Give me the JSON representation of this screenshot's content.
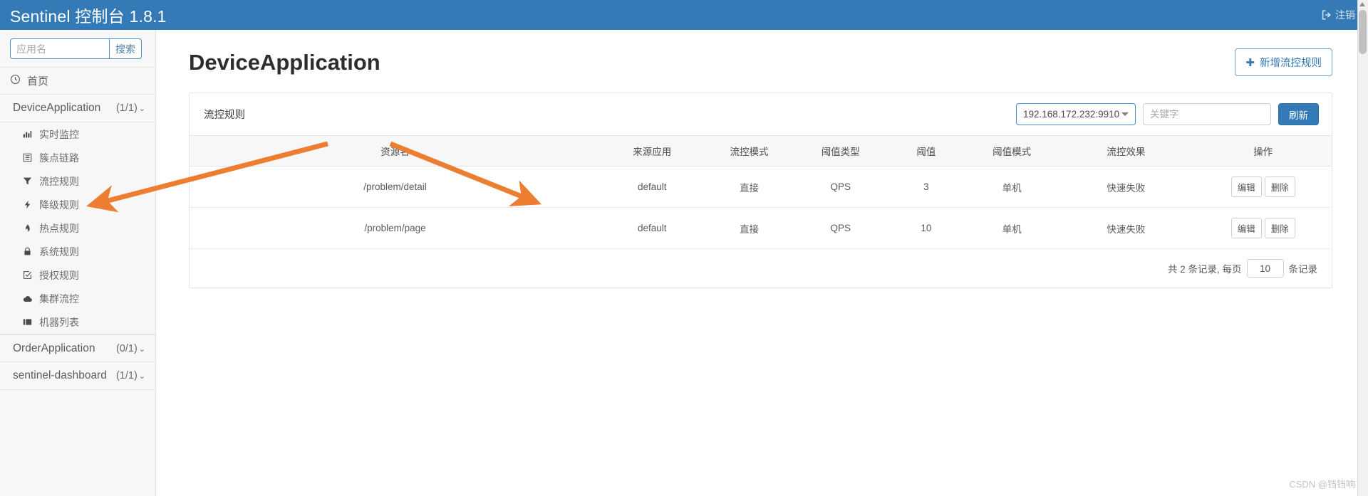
{
  "header": {
    "brand": "Sentinel 控制台 1.8.1",
    "logout_label": "注销",
    "bg_color": "#337ab7"
  },
  "sidebar": {
    "search": {
      "placeholder": "应用名",
      "value": "",
      "button_label": "搜索"
    },
    "home_label": "首页",
    "groups": [
      {
        "name": "DeviceApplication",
        "count": "(1/1)",
        "chevron": "⌄",
        "expanded": true,
        "items": [
          {
            "icon": "chart-bar-icon",
            "label": "实时监控"
          },
          {
            "icon": "list-icon",
            "label": "簇点链路"
          },
          {
            "icon": "filter-icon",
            "label": "流控规则",
            "active": true
          },
          {
            "icon": "bolt-icon",
            "label": "降级规则"
          },
          {
            "icon": "fire-icon",
            "label": "热点规则"
          },
          {
            "icon": "lock-icon",
            "label": "系统规则"
          },
          {
            "icon": "check-square-icon",
            "label": "授权规则"
          },
          {
            "icon": "cloud-icon",
            "label": "集群流控"
          },
          {
            "icon": "server-icon",
            "label": "机器列表"
          }
        ]
      },
      {
        "name": "OrderApplication",
        "count": "(0/1)",
        "chevron": "⌄",
        "expanded": false,
        "items": []
      },
      {
        "name": "sentinel-dashboard",
        "count": "(1/1)",
        "chevron": "⌄",
        "expanded": false,
        "items": []
      }
    ]
  },
  "main": {
    "page_title": "DeviceApplication",
    "add_button": {
      "icon": "plus-icon",
      "label": "新增流控规则"
    },
    "card": {
      "title": "流控规则",
      "machine_select": {
        "value": "192.168.172.232:9910"
      },
      "keyword_input": {
        "placeholder": "关键字",
        "value": ""
      },
      "refresh_label": "刷新",
      "columns": [
        "资源名",
        "来源应用",
        "流控模式",
        "阈值类型",
        "阈值",
        "阈值模式",
        "流控效果",
        "操作"
      ],
      "rows": [
        {
          "resource": "/problem/detail",
          "origin": "default",
          "mode": "直接",
          "threshold_type": "QPS",
          "threshold": "3",
          "threshold_mode": "单机",
          "effect": "快速失败",
          "edit_label": "编辑",
          "delete_label": "删除"
        },
        {
          "resource": "/problem/page",
          "origin": "default",
          "mode": "直接",
          "threshold_type": "QPS",
          "threshold": "10",
          "threshold_mode": "单机",
          "effect": "快速失败",
          "edit_label": "编辑",
          "delete_label": "删除"
        }
      ],
      "footer": {
        "total_prefix": "共 2 条记录, 每页",
        "page_size": "10",
        "total_suffix": "条记录"
      }
    }
  },
  "annotations": {
    "arrow_color": "#ed7d31",
    "arrow_count": 2
  },
  "watermark": "CSDN @铛铛响"
}
